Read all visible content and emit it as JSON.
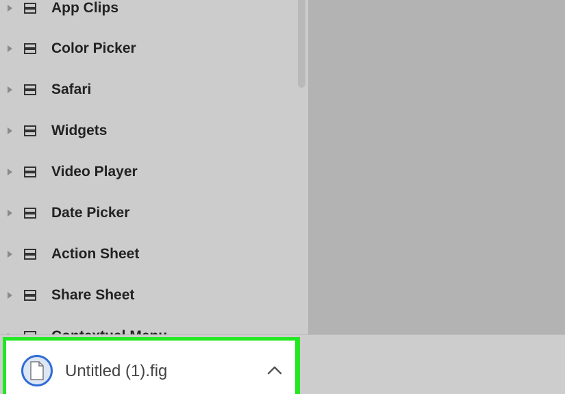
{
  "layers_panel": {
    "items": [
      {
        "label": "App Clips"
      },
      {
        "label": "Color Picker"
      },
      {
        "label": "Safari"
      },
      {
        "label": "Widgets"
      },
      {
        "label": "Video Player"
      },
      {
        "label": "Date Picker"
      },
      {
        "label": "Action Sheet"
      },
      {
        "label": "Share Sheet"
      },
      {
        "label": "Contextual Menu"
      }
    ],
    "item_icon": "frame-icon",
    "expand_icon": "caret-right-icon"
  },
  "download_bar": {
    "file_name": "Untitled (1).fig",
    "file_icon": "file-icon",
    "toggle_icon": "chevron-up-icon",
    "highlight_color": "#22e822"
  },
  "colors": {
    "panel_bg": "#cccccc",
    "canvas_bg": "#b3b3b3",
    "accent_blue": "#2f6dd6"
  }
}
